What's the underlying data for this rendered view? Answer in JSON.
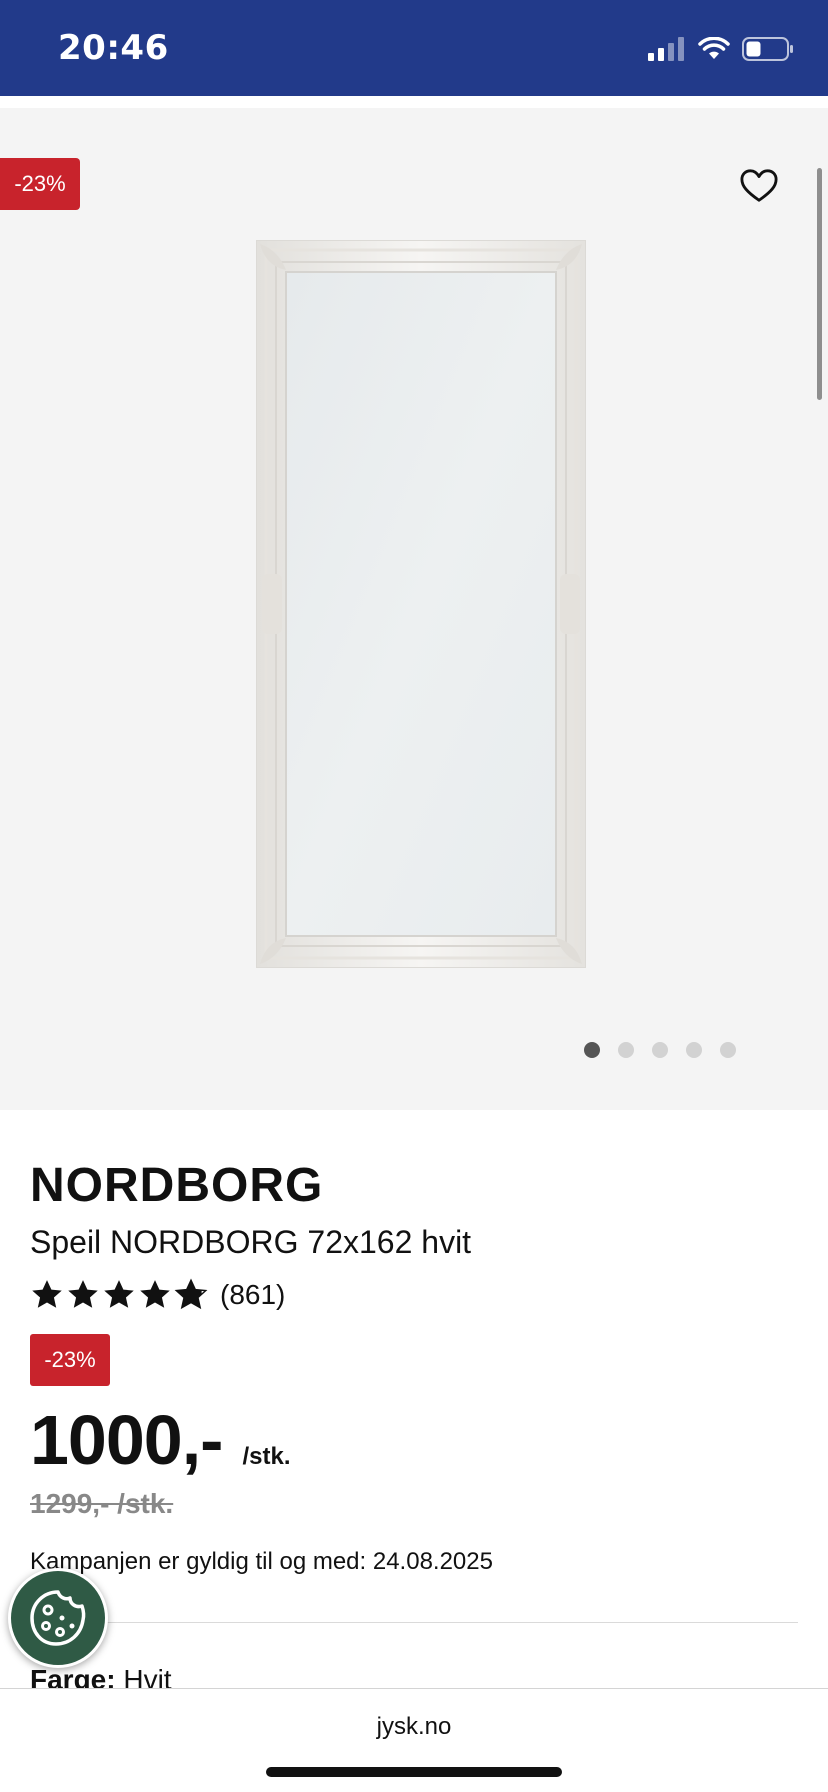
{
  "status_bar": {
    "time": "20:46",
    "background_color": "#223A8A",
    "icons": [
      "cellular-signal-icon",
      "wifi-icon",
      "battery-icon"
    ]
  },
  "gallery": {
    "discount_badge": "-23%",
    "favorite_icon": "heart-outline-icon",
    "image_alt": "Speil NORDBORG 72x162 hvit",
    "slide_count": 5,
    "active_slide": 1
  },
  "product": {
    "brand": "NORDBORG",
    "name": "Speil NORDBORG 72x162 hvit",
    "rating_stars": 4.8,
    "review_count": "(861)",
    "discount_badge": "-23%",
    "price": "1000,-",
    "price_unit": "/stk.",
    "old_price": "1299,- /stk.",
    "campaign_text": "Kampanjen er gyldig til og med: 24.08.2025",
    "color_label": "Farge:",
    "color_value": "Hvit"
  },
  "cookie_button": {
    "icon": "cookie-icon",
    "background_color": "#2F5A45"
  },
  "browser": {
    "url": "jysk.no"
  },
  "colors": {
    "discount_red": "#C8232C",
    "image_background": "#F4F4F4",
    "old_price_gray": "#888888"
  }
}
